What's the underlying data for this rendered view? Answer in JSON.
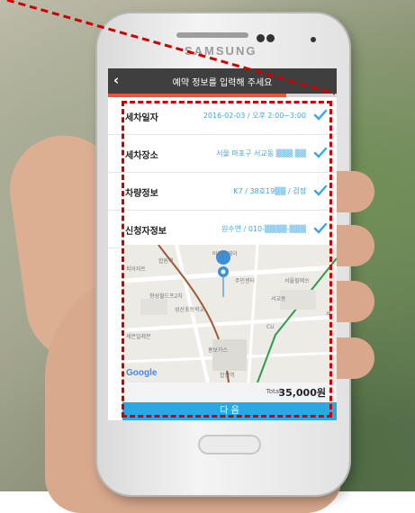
{
  "device": {
    "brand": "SAMSUNG"
  },
  "app": {
    "title": "예약 정보를 입력해 주세요",
    "back_icon": "chevron-left-icon",
    "progress": 0.78,
    "accent": "#2aa8e3",
    "progress_color": "#e9543c"
  },
  "rows": [
    {
      "label": "세차일자",
      "value": "2016-02-03 / 오후 2:00~3:00"
    },
    {
      "label": "세차장소",
      "value": "서울 마포구 서교동 ▒▒▒ ▒▒"
    },
    {
      "label": "차량정보",
      "value": "K7 /  38호19▒▒ / 검정"
    },
    {
      "label": "신청자정보",
      "value": "원수연 / 010-▒▒▒▒-▒▒▒"
    }
  ],
  "map": {
    "labels": [
      "바이더웨이",
      "합원역",
      "피아자트",
      "청성월드프2차",
      "성산초등학교",
      "주민센터",
      "서울힐에쓰",
      "서교동",
      "세븐일레븐",
      "홍보가스",
      "합정역",
      "세",
      "CU"
    ],
    "attribution": "Google"
  },
  "total": {
    "label": "Total",
    "amount": "35,000원"
  },
  "next_button": "다 음"
}
